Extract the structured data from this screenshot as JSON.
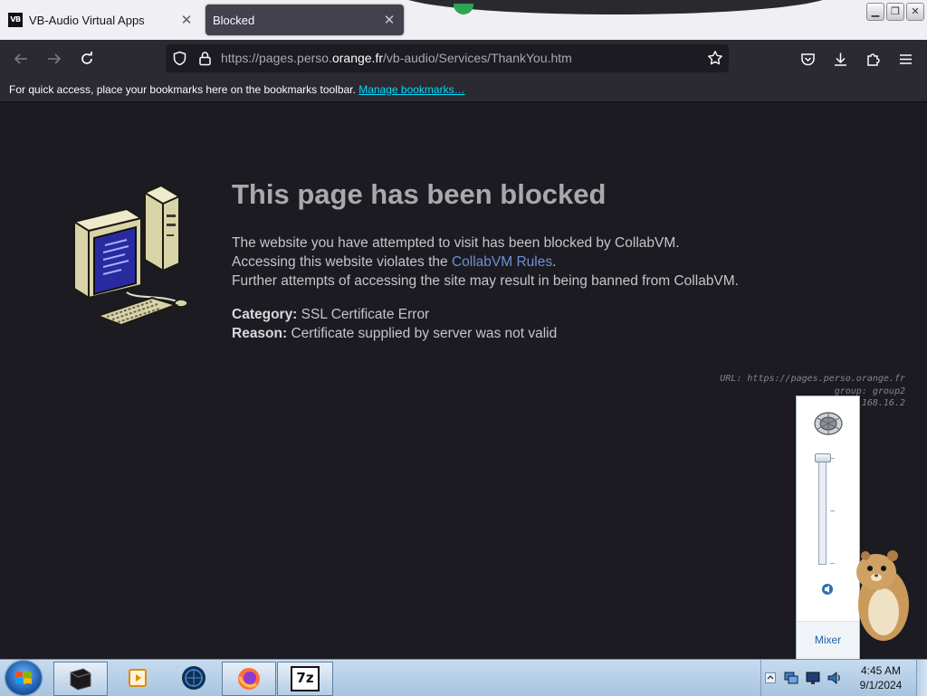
{
  "browser": {
    "tabs": [
      {
        "title": "VB-Audio Virtual Apps",
        "icon": "vb-audio-icon",
        "icon_text": "VB",
        "active": false
      },
      {
        "title": "Blocked",
        "active": true
      }
    ],
    "url": {
      "prefix": "https://pages.perso.",
      "domain": "orange.fr",
      "path": "/vb-audio/Services/ThankYou.htm"
    },
    "bookmarks_bar": {
      "text": "For quick access, place your bookmarks here on the bookmarks toolbar.",
      "link": "Manage bookmarks…"
    }
  },
  "blocked_page": {
    "title": "This page has been blocked",
    "line1": "The website you have attempted to visit has been blocked by CollabVM.",
    "line2_prefix": "Accessing this website violates the ",
    "line2_link": "CollabVM Rules",
    "line2_suffix": ".",
    "line3": "Further attempts of accessing the site may result in being banned from CollabVM.",
    "category_label": "Category:",
    "category_value": "SSL Certificate Error",
    "reason_label": "Reason:",
    "reason_value": "Certificate supplied by server was not valid",
    "meta": {
      "url_line": "URL: https://pages.perso.orange.fr",
      "group_line": "group: group2",
      "ip_line": "168.16.2"
    }
  },
  "volume_popup": {
    "mixer_label": "Mixer",
    "level": 1.0
  },
  "taskbar": {
    "apps": [
      "terminal-app-icon",
      "media-player-icon",
      "globe-icon",
      "firefox-icon",
      "7zip-icon"
    ],
    "sevenzip_text": "7z",
    "clock": {
      "time": "4:45 AM",
      "date": "9/1/2024"
    }
  },
  "colors": {
    "page_bg": "#1c1b22",
    "toolbar_bg": "#2b2a33",
    "link": "#00ddff",
    "rules_link": "#6f8fd6",
    "taskbar": "#b8d0ea"
  }
}
